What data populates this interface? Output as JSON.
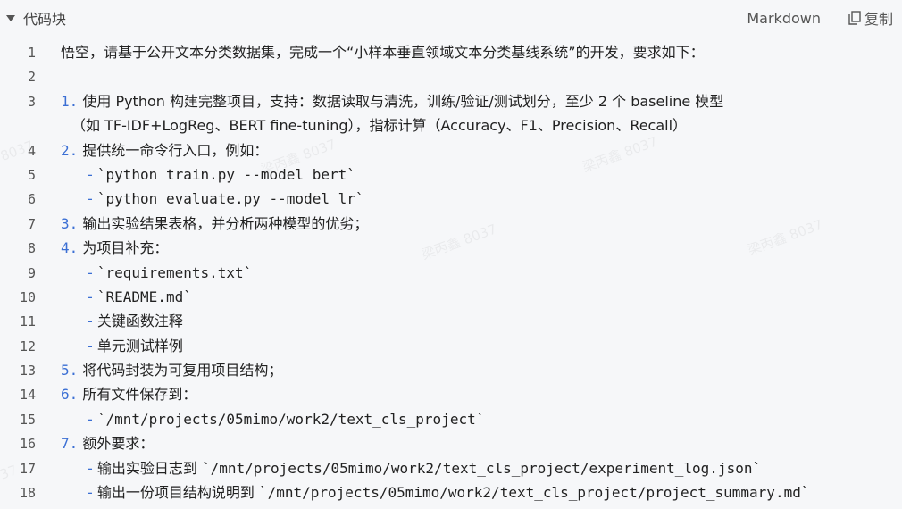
{
  "header": {
    "title": "代码块",
    "language": "Markdown",
    "copy_label": "复制"
  },
  "lines": [
    {
      "n": "1",
      "num": "",
      "dash": "",
      "text": "悟空，请基于公开文本分类数据集，完成一个“小样本垂直领域文本分类基线系统”的开发，要求如下："
    },
    {
      "n": "2",
      "num": "",
      "dash": "",
      "text": ""
    },
    {
      "n": "3",
      "num": "1.",
      "dash": "",
      "text": " 使用 Python 构建完整项目，支持：数据读取与清洗，训练/验证/测试划分，至少 2 个 baseline 模型"
    },
    {
      "n": "",
      "num": "",
      "dash": "",
      "text": "（如 TF-IDF+LogReg、BERT fine-tuning），指标计算（Accuracy、F1、Precision、Recall）"
    },
    {
      "n": "4",
      "num": "2.",
      "dash": "",
      "text": " 提供统一命令行入口，例如："
    },
    {
      "n": "5",
      "num": "",
      "dash": "-",
      "text": " `python train.py --model bert`"
    },
    {
      "n": "6",
      "num": "",
      "dash": "-",
      "text": " `python evaluate.py --model lr`"
    },
    {
      "n": "7",
      "num": "3.",
      "dash": "",
      "text": " 输出实验结果表格，并分析两种模型的优劣；"
    },
    {
      "n": "8",
      "num": "4.",
      "dash": "",
      "text": " 为项目补充："
    },
    {
      "n": "9",
      "num": "",
      "dash": "-",
      "text": " `requirements.txt`"
    },
    {
      "n": "10",
      "num": "",
      "dash": "-",
      "text": " `README.md`"
    },
    {
      "n": "11",
      "num": "",
      "dash": "-",
      "text": " 关键函数注释"
    },
    {
      "n": "12",
      "num": "",
      "dash": "-",
      "text": " 单元测试样例"
    },
    {
      "n": "13",
      "num": "5.",
      "dash": "",
      "text": " 将代码封装为可复用项目结构；"
    },
    {
      "n": "14",
      "num": "6.",
      "dash": "",
      "text": " 所有文件保存到："
    },
    {
      "n": "15",
      "num": "",
      "dash": "-",
      "text": " `/mnt/projects/05mimo/work2/text_cls_project`"
    },
    {
      "n": "16",
      "num": "7.",
      "dash": "",
      "text": " 额外要求："
    },
    {
      "n": "17",
      "num": "",
      "dash": "-",
      "text": " 输出实验日志到 `/mnt/projects/05mimo/work2/text_cls_project/experiment_log.json`"
    },
    {
      "n": "18",
      "num": "",
      "dash": "-",
      "text": " 输出一份项目结构说明到 `/mnt/projects/05mimo/work2/text_cls_project/project_summary.md`"
    }
  ],
  "watermarks": [
    "梁丙鑫 8037",
    "梁丙鑫 8037",
    "梁丙鑫 8037",
    "梁丙鑫 8037",
    "8037",
    "37"
  ]
}
